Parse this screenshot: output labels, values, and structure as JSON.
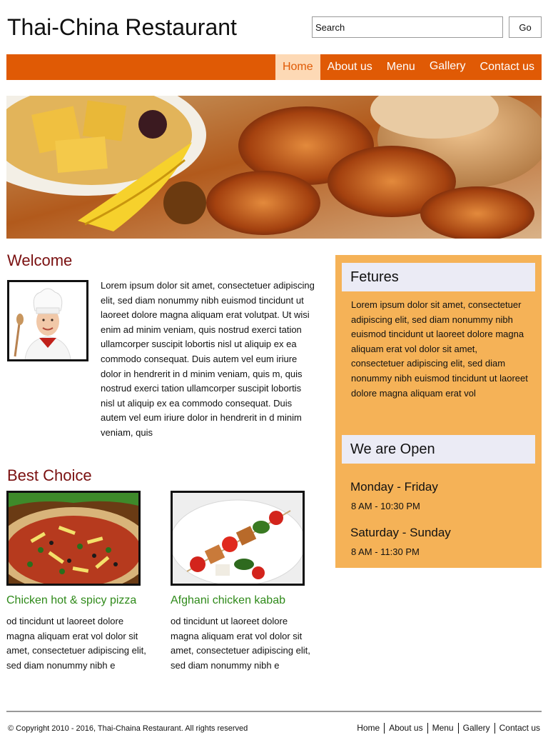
{
  "header": {
    "site_title": "Thai-China Restaurant",
    "search_placeholder": "Search",
    "go_label": "Go"
  },
  "nav": {
    "items": [
      {
        "label": "Home",
        "active": true
      },
      {
        "label": "About us"
      },
      {
        "label": "Menu"
      },
      {
        "label": "Gallery"
      },
      {
        "label": "Contact us"
      }
    ]
  },
  "welcome": {
    "heading": "Welcome",
    "text": "Lorem ipsum dolor sit amet, consectetuer adipiscing elit, sed diam nonummy nibh euismod tincidunt ut laoreet dolore magna aliquam erat volutpat. Ut wisi enim ad minim veniam, quis nostrud exerci tation ullamcorper suscipit lobortis nisl ut aliquip ex ea commodo consequat. Duis autem vel eum iriure dolor in hendrerit in d minim veniam, quis  m, quis nostrud exerci tation ullamcorper suscipit lobortis nisl ut aliquip ex ea commodo consequat. Duis autem vel eum iriure dolor in hendrerit in d minim veniam, quis"
  },
  "best_choice": {
    "heading": "Best Choice",
    "dishes": [
      {
        "title": "Chicken hot & spicy pizza",
        "text": "od tincidunt ut laoreet dolore magna aliquam erat vol  dolor sit amet, consectetuer adipiscing elit, sed diam nonummy nibh e"
      },
      {
        "title": "Afghani chicken kabab",
        "text": "od tincidunt ut laoreet dolore magna aliquam erat vol  dolor sit amet, consectetuer adipiscing elit, sed diam nonummy nibh e"
      }
    ]
  },
  "sidebar": {
    "features_heading": "Fetures",
    "features_text": "Lorem ipsum dolor sit amet, consectetuer adipiscing elit, sed diam nonummy nibh euismod tincidunt ut laoreet dolore magna aliquam erat vol dolor sit amet, consectetuer adipiscing elit, sed diam nonummy nibh euismod tincidunt ut laoreet dolore magna aliquam erat vol",
    "open_heading": "We are Open",
    "hours": [
      {
        "days": "Monday - Friday",
        "time": "8 AM - 10:30 PM"
      },
      {
        "days": "Saturday - Sunday",
        "time": "8 AM - 11:30 PM"
      }
    ]
  },
  "footer": {
    "copyright": "© Copyright 2010 - 2016, Thai-Chaina Restaurant. All rights reserved",
    "links": [
      "Home",
      "About us",
      "Menu",
      "Gallery",
      "Contact us"
    ]
  },
  "colors": {
    "nav_bar": "#e05a05",
    "nav_active_bg": "#fdd9b5",
    "heading_red": "#7a1010",
    "dish_title_green": "#2f8a1a",
    "sidebar_bg": "#f5b257",
    "sidebar_heading_bg": "#ebebf5"
  },
  "images": {
    "hero": "food-banner-photo",
    "chef": "chef-photo",
    "dish_1": "pizza-photo",
    "dish_2": "kabab-photo"
  }
}
